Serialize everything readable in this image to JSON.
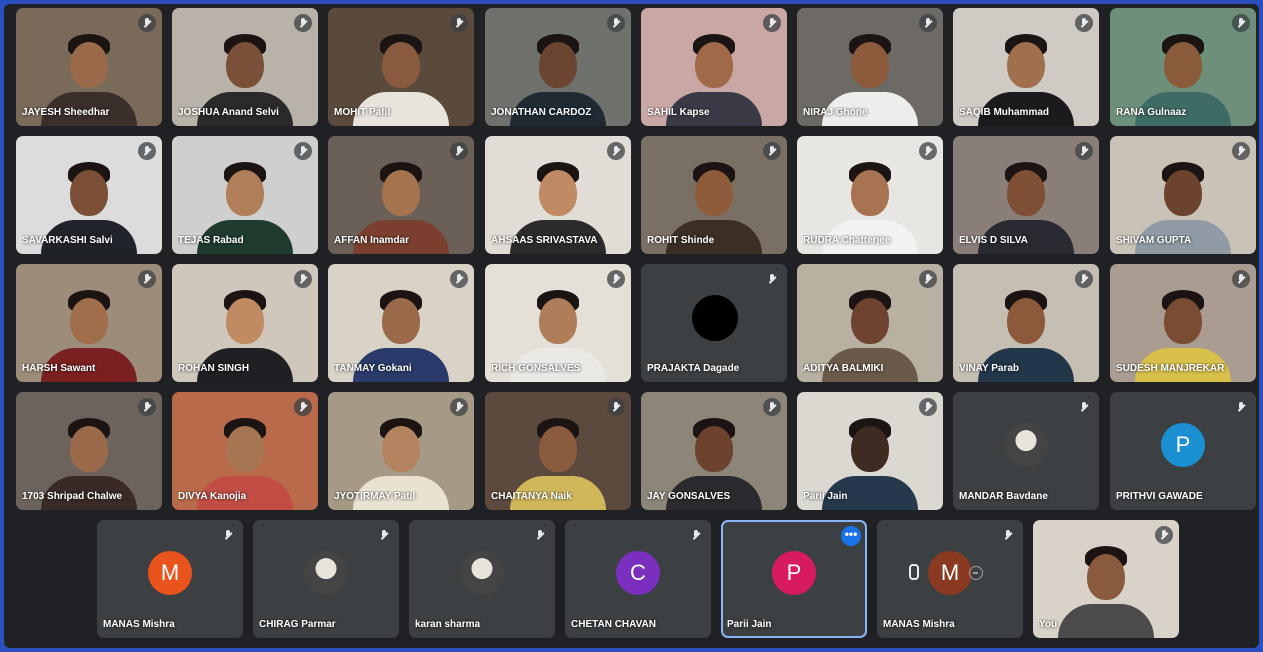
{
  "participants": [
    {
      "name": "JAYESH Sheedhar",
      "kind": "video",
      "skin": "#9a6a4a",
      "shirt": "#3a2f2a",
      "bg": "#7a6a5a"
    },
    {
      "name": "JOSHUA Anand Selvi",
      "kind": "video",
      "skin": "#7a5038",
      "shirt": "#2a2a2a",
      "bg": "#b9b2a8"
    },
    {
      "name": "MOHIT Patil",
      "kind": "video",
      "skin": "#8a5a3e",
      "shirt": "#e8e4dc",
      "bg": "#5a4a3c"
    },
    {
      "name": "JONATHAN CARDOZ",
      "kind": "video",
      "skin": "#6a4632",
      "shirt": "#1f2a33",
      "bg": "#6f716c"
    },
    {
      "name": "SAHIL Kapse",
      "kind": "video",
      "skin": "#a06a48",
      "shirt": "#3a3a46",
      "bg": "#c9a7a4"
    },
    {
      "name": "NIRAJ Ghone",
      "kind": "video",
      "skin": "#8d5a3b",
      "shirt": "#ededeb",
      "bg": "#6d6a66"
    },
    {
      "name": "SAQIB Muhammad",
      "kind": "video",
      "skin": "#a0704e",
      "shirt": "#1b1b1d",
      "bg": "#cfcac4"
    },
    {
      "name": "RANA Gulnaaz",
      "kind": "video",
      "skin": "#8a5c3c",
      "shirt": "#3f6b66",
      "bg": "#6e8f7a"
    },
    {
      "name": "SAVARKASHI Salvi",
      "kind": "video",
      "skin": "#7b4f36",
      "shirt": "#20232a",
      "bg": "#dcdcdc"
    },
    {
      "name": "TEJAS Rabad",
      "kind": "video",
      "skin": "#b07f5a",
      "shirt": "#1f3b2d",
      "bg": "#cfcfcf"
    },
    {
      "name": "AFFAN Inamdar",
      "kind": "video",
      "skin": "#a5734e",
      "shirt": "#7a3f2e",
      "bg": "#6a6058"
    },
    {
      "name": "AHSAAS SRIVASTAVA",
      "kind": "video",
      "skin": "#c08a64",
      "shirt": "#2b2b2b",
      "bg": "#e1ddd6"
    },
    {
      "name": "ROHIT Shinde",
      "kind": "video",
      "skin": "#8e5c3b",
      "shirt": "#3b2f25",
      "bg": "#7a6f63"
    },
    {
      "name": "RUDRA Chatterjee",
      "kind": "video",
      "skin": "#a77352",
      "shirt": "#f2f2f0",
      "bg": "#e8e6e2"
    },
    {
      "name": "ELVIS D SILVA",
      "kind": "video",
      "skin": "#7f4f35",
      "shirt": "#2a2a33",
      "bg": "#8a7f78"
    },
    {
      "name": "SHIVAM GUPTA",
      "kind": "video",
      "skin": "#6b432f",
      "shirt": "#8f9aa4",
      "bg": "#c9c2b6"
    },
    {
      "name": "HARSH Sawant",
      "kind": "video",
      "skin": "#a06e4b",
      "shirt": "#7a2020",
      "bg": "#9c8c7a"
    },
    {
      "name": "ROHAN SINGH",
      "kind": "video",
      "skin": "#c08a62",
      "shirt": "#1f1f24",
      "bg": "#cfc7bc"
    },
    {
      "name": "TANMAY Gokani",
      "kind": "video",
      "skin": "#9a6a4a",
      "shirt": "#2a3a6a",
      "bg": "#d9d3c7"
    },
    {
      "name": "RICH GONSALVES",
      "kind": "video",
      "skin": "#b07d5a",
      "shirt": "#eae9e5",
      "bg": "#e4e0d8"
    },
    {
      "name": "PRAJAKTA Dagade",
      "kind": "blackcircle",
      "bg": "#3c4043"
    },
    {
      "name": "ADITYA BALMIKI",
      "kind": "video",
      "skin": "#6e4430",
      "shirt": "#6a5a4a",
      "bg": "#b8b0a0"
    },
    {
      "name": "VINAY Parab",
      "kind": "video",
      "skin": "#8c5a3b",
      "shirt": "#22364a",
      "bg": "#c5bfb3"
    },
    {
      "name": "SUDESH MANJREKAR",
      "kind": "video",
      "skin": "#7a4c33",
      "shirt": "#d8c04a",
      "bg": "#aa9c91"
    },
    {
      "name": "1703 Shripad Chalwe",
      "kind": "video",
      "skin": "#9a6a4a",
      "shirt": "#3a2a25",
      "bg": "#6c645c"
    },
    {
      "name": "DIVYA Kanojia",
      "kind": "video",
      "skin": "#a67552",
      "shirt": "#c24d44",
      "bg": "#b86a4a"
    },
    {
      "name": "JYOTIRMAY Patil",
      "kind": "video",
      "skin": "#b3845f",
      "shirt": "#e9e2d3",
      "bg": "#a69a86"
    },
    {
      "name": "CHAITANYA Naik",
      "kind": "video",
      "skin": "#8b5b3e",
      "shirt": "#cfb75a",
      "bg": "#5c4a3e"
    },
    {
      "name": "JAY GONSALVES",
      "kind": "video",
      "skin": "#6d432e",
      "shirt": "#2a2a2e",
      "bg": "#8c8578"
    },
    {
      "name": "Parii Jain",
      "kind": "video",
      "skin": "#3e2b22",
      "shirt": "#26394c",
      "bg": "#dbd8d2"
    },
    {
      "name": "MANDAR Bavdane",
      "kind": "image",
      "bg": "#3c4043"
    },
    {
      "name": "PRITHVI GAWADE",
      "kind": "avatar",
      "letter": "P",
      "color": "#1a8fd1",
      "bg": "#3c4043"
    }
  ],
  "bottom_row": [
    {
      "name": "MANAS Mishra",
      "kind": "avatar",
      "letter": "M",
      "color": "#e8541c"
    },
    {
      "name": "CHIRAG Parmar",
      "kind": "image"
    },
    {
      "name": "karan sharma",
      "kind": "image"
    },
    {
      "name": "CHETAN CHAVAN",
      "kind": "avatar",
      "letter": "C",
      "color": "#7b2fbf"
    },
    {
      "name": "Parii Jain",
      "kind": "avatar",
      "letter": "P",
      "color": "#d81b60",
      "selected": true,
      "menu": "•••"
    },
    {
      "name": "MANAS Mishra",
      "kind": "avatar-dim",
      "letter": "M",
      "color": "#8a3a20"
    },
    {
      "name": "You",
      "kind": "self-video"
    }
  ],
  "colors": {
    "frame": "#2b4fbf",
    "stage": "#202124",
    "tile": "#3c4043",
    "select": "#8ab4f8"
  }
}
